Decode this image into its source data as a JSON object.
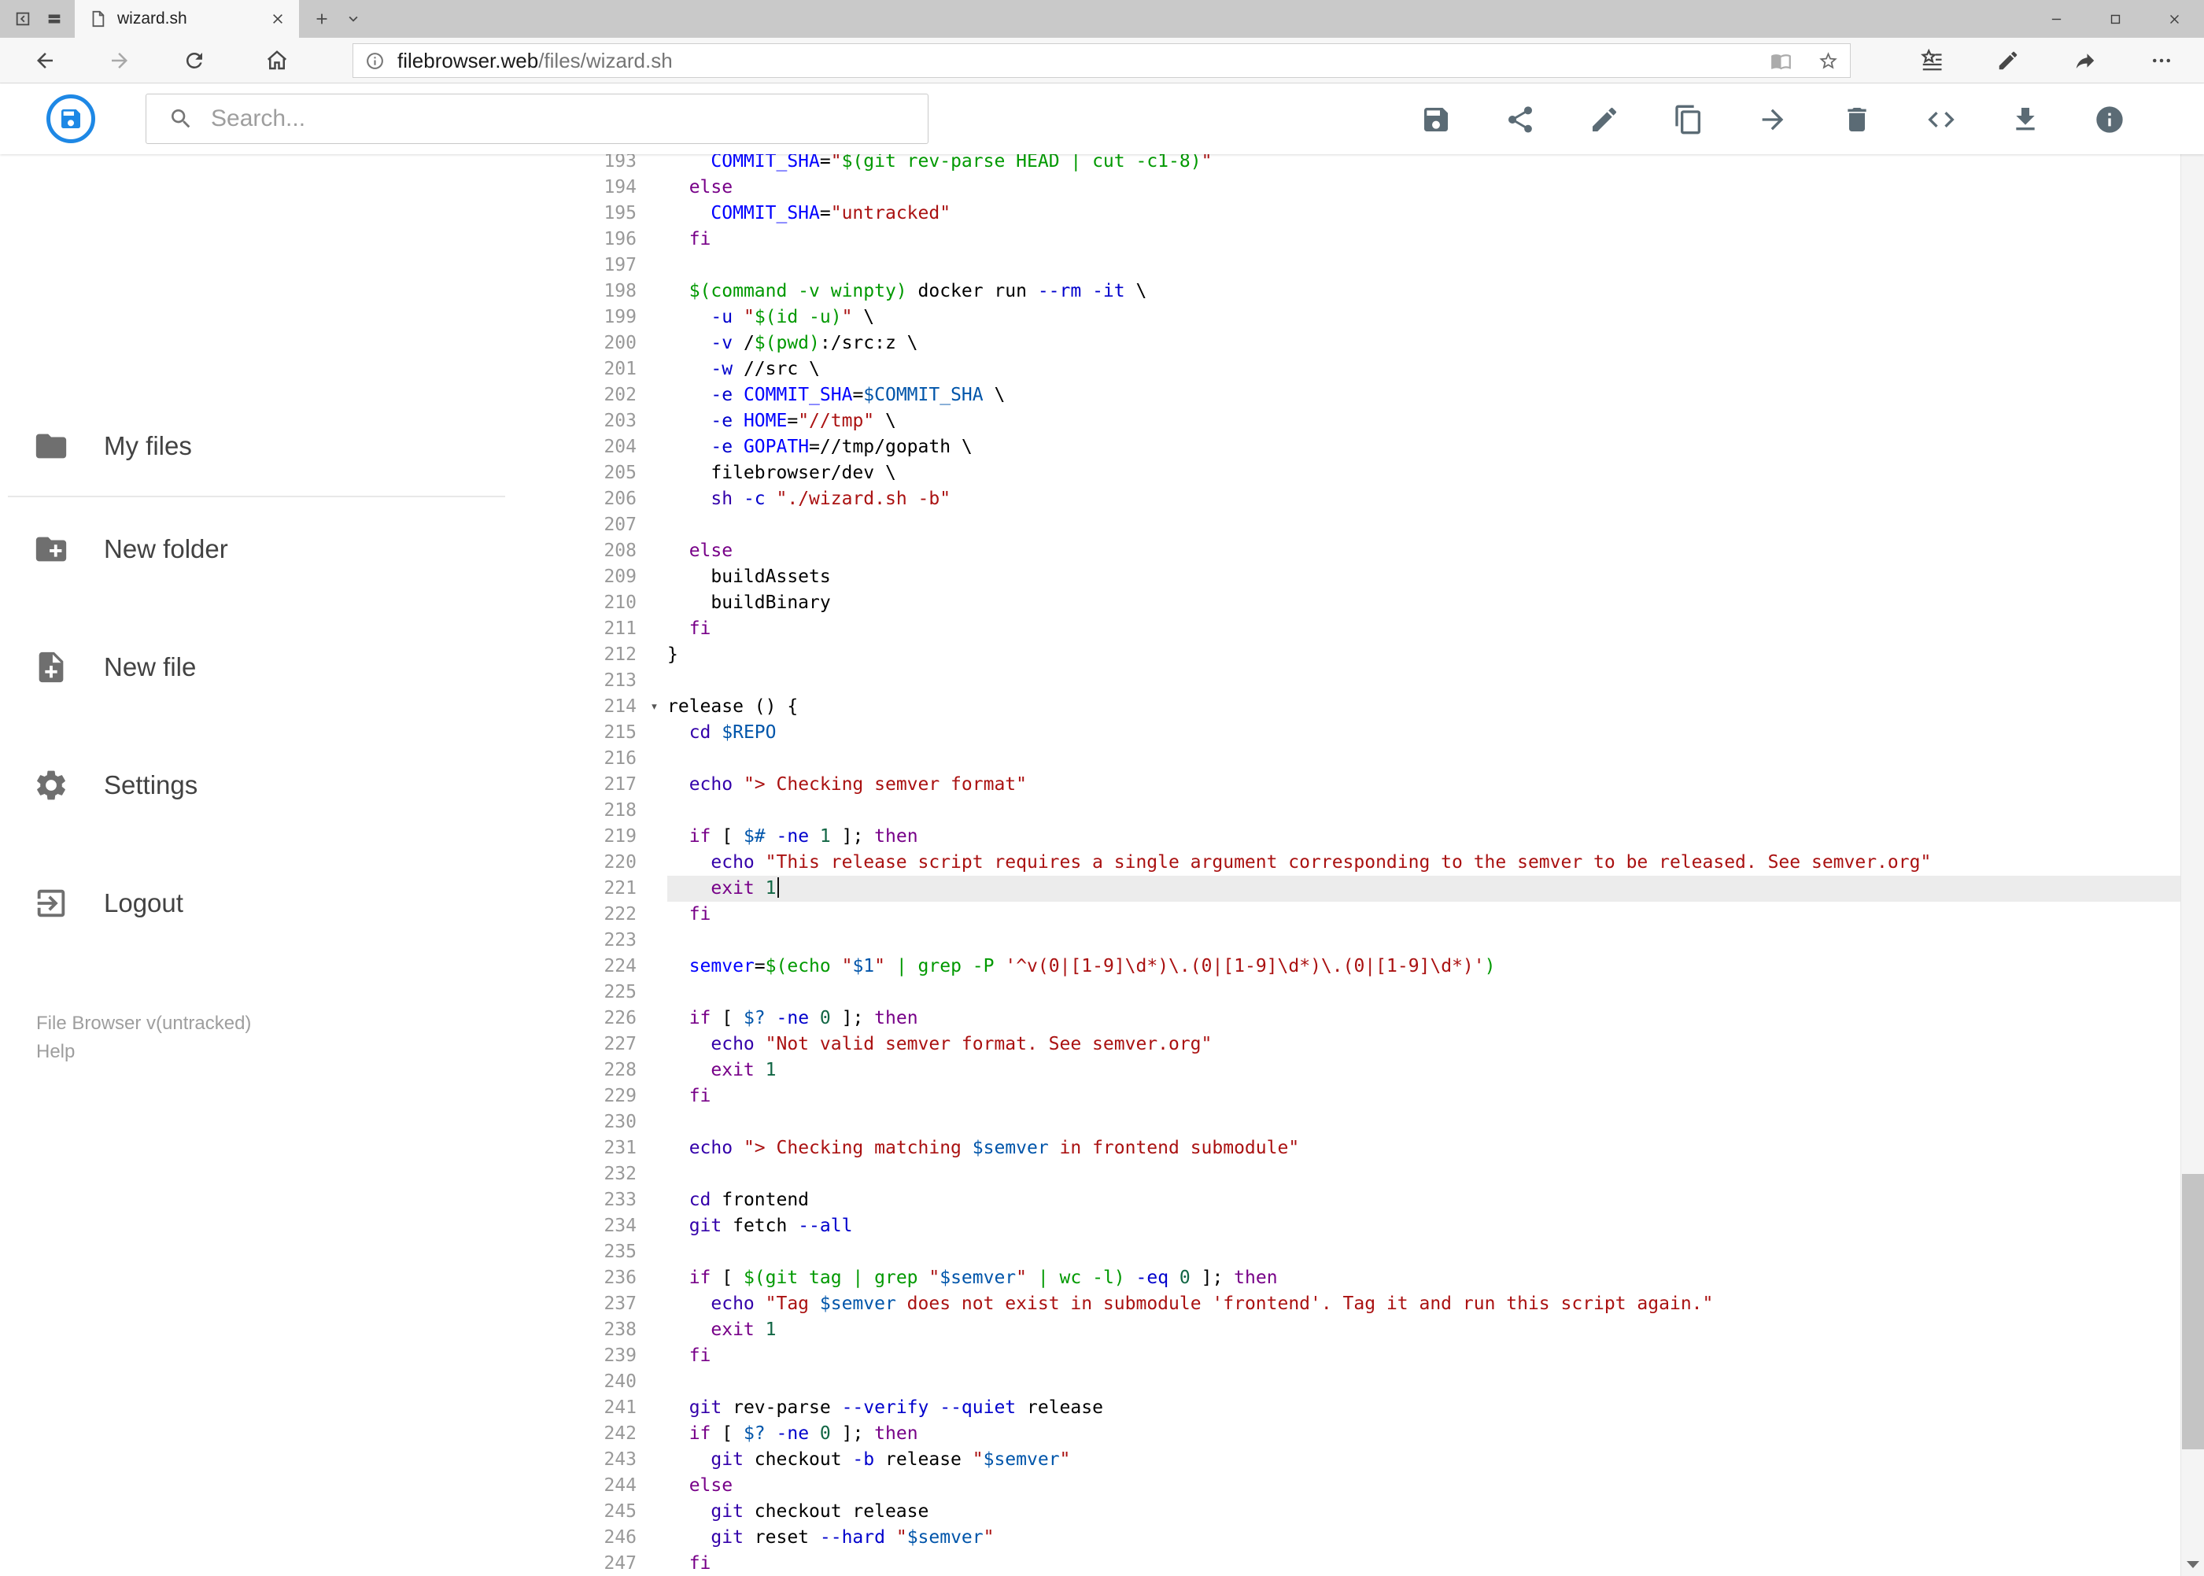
{
  "browser": {
    "tab_title": "wizard.sh",
    "url_domain": "filebrowser.web",
    "url_path": "/files/wizard.sh"
  },
  "header": {
    "search_placeholder": "Search...",
    "accent_color": "#1e88e5",
    "toolbar_icons": [
      "save",
      "share",
      "edit",
      "copy",
      "move",
      "delete",
      "code",
      "download",
      "info"
    ]
  },
  "sidebar": {
    "items": [
      {
        "label": "My files",
        "icon": "folder"
      },
      {
        "label": "New folder",
        "icon": "folder-plus"
      },
      {
        "label": "New file",
        "icon": "file-plus"
      },
      {
        "label": "Settings",
        "icon": "gear"
      },
      {
        "label": "Logout",
        "icon": "logout"
      }
    ],
    "version": "File Browser v(untracked)",
    "help": "Help"
  },
  "editor": {
    "active_line": 221,
    "fold_markers": [
      214
    ],
    "syntax_colors": {
      "keyword": "#708",
      "builtin": "#30a",
      "attribute": "#00c",
      "number": "#164",
      "string": "#a11",
      "quote": "#090",
      "variable": "#05a",
      "def": "#00f",
      "plain": "#000",
      "line_number": "#999",
      "active_line_bg": "#ececec"
    },
    "lines": [
      {
        "n": 193,
        "t": [
          [
            "p",
            "    "
          ],
          [
            "def",
            "COMMIT_SHA"
          ],
          [
            "p",
            "="
          ],
          [
            "s",
            "\""
          ],
          [
            "q",
            "$(git rev-parse HEAD | cut -c1-8)"
          ],
          [
            "s",
            "\""
          ]
        ]
      },
      {
        "n": 194,
        "t": [
          [
            "p",
            "  "
          ],
          [
            "kw",
            "else"
          ]
        ]
      },
      {
        "n": 195,
        "t": [
          [
            "p",
            "    "
          ],
          [
            "def",
            "COMMIT_SHA"
          ],
          [
            "p",
            "="
          ],
          [
            "s",
            "\"untracked\""
          ]
        ]
      },
      {
        "n": 196,
        "t": [
          [
            "p",
            "  "
          ],
          [
            "kw",
            "fi"
          ]
        ]
      },
      {
        "n": 197,
        "t": []
      },
      {
        "n": 198,
        "t": [
          [
            "p",
            "  "
          ],
          [
            "q",
            "$(command -v winpty)"
          ],
          [
            "p",
            " docker run "
          ],
          [
            "at",
            "--rm"
          ],
          [
            "p",
            " "
          ],
          [
            "at",
            "-it"
          ],
          [
            "p",
            " \\"
          ]
        ]
      },
      {
        "n": 199,
        "t": [
          [
            "p",
            "    "
          ],
          [
            "at",
            "-u"
          ],
          [
            "p",
            " "
          ],
          [
            "s",
            "\""
          ],
          [
            "q",
            "$(id -u)"
          ],
          [
            "s",
            "\""
          ],
          [
            "p",
            " \\"
          ]
        ]
      },
      {
        "n": 200,
        "t": [
          [
            "p",
            "    "
          ],
          [
            "at",
            "-v"
          ],
          [
            "p",
            " /"
          ],
          [
            "q",
            "$(pwd)"
          ],
          [
            "p",
            ":/src:z \\"
          ]
        ]
      },
      {
        "n": 201,
        "t": [
          [
            "p",
            "    "
          ],
          [
            "at",
            "-w"
          ],
          [
            "p",
            " //src \\"
          ]
        ]
      },
      {
        "n": 202,
        "t": [
          [
            "p",
            "    "
          ],
          [
            "at",
            "-e"
          ],
          [
            "p",
            " "
          ],
          [
            "def",
            "COMMIT_SHA"
          ],
          [
            "p",
            "="
          ],
          [
            "v",
            "$COMMIT_SHA"
          ],
          [
            "p",
            " \\"
          ]
        ]
      },
      {
        "n": 203,
        "t": [
          [
            "p",
            "    "
          ],
          [
            "at",
            "-e"
          ],
          [
            "p",
            " "
          ],
          [
            "def",
            "HOME"
          ],
          [
            "p",
            "="
          ],
          [
            "s",
            "\"//tmp\""
          ],
          [
            "p",
            " \\"
          ]
        ]
      },
      {
        "n": 204,
        "t": [
          [
            "p",
            "    "
          ],
          [
            "at",
            "-e"
          ],
          [
            "p",
            " "
          ],
          [
            "def",
            "GOPATH"
          ],
          [
            "p",
            "=//tmp/gopath \\"
          ]
        ]
      },
      {
        "n": 205,
        "t": [
          [
            "p",
            "    filebrowser/dev \\"
          ]
        ]
      },
      {
        "n": 206,
        "t": [
          [
            "p",
            "    "
          ],
          [
            "bi",
            "sh"
          ],
          [
            "p",
            " "
          ],
          [
            "at",
            "-c"
          ],
          [
            "p",
            " "
          ],
          [
            "s",
            "\"./wizard.sh -b\""
          ]
        ]
      },
      {
        "n": 207,
        "t": []
      },
      {
        "n": 208,
        "t": [
          [
            "p",
            "  "
          ],
          [
            "kw",
            "else"
          ]
        ]
      },
      {
        "n": 209,
        "t": [
          [
            "p",
            "    buildAssets"
          ]
        ]
      },
      {
        "n": 210,
        "t": [
          [
            "p",
            "    buildBinary"
          ]
        ]
      },
      {
        "n": 211,
        "t": [
          [
            "p",
            "  "
          ],
          [
            "kw",
            "fi"
          ]
        ]
      },
      {
        "n": 212,
        "t": [
          [
            "p",
            "}"
          ]
        ]
      },
      {
        "n": 213,
        "t": []
      },
      {
        "n": 214,
        "t": [
          [
            "p",
            "release () {"
          ]
        ]
      },
      {
        "n": 215,
        "t": [
          [
            "p",
            "  "
          ],
          [
            "bi",
            "cd"
          ],
          [
            "p",
            " "
          ],
          [
            "v",
            "$REPO"
          ]
        ]
      },
      {
        "n": 216,
        "t": []
      },
      {
        "n": 217,
        "t": [
          [
            "p",
            "  "
          ],
          [
            "bi",
            "echo"
          ],
          [
            "p",
            " "
          ],
          [
            "s",
            "\"> Checking semver format\""
          ]
        ]
      },
      {
        "n": 218,
        "t": []
      },
      {
        "n": 219,
        "t": [
          [
            "p",
            "  "
          ],
          [
            "kw",
            "if"
          ],
          [
            "p",
            " [ "
          ],
          [
            "v",
            "$#"
          ],
          [
            "p",
            " "
          ],
          [
            "at",
            "-ne"
          ],
          [
            "p",
            " "
          ],
          [
            "num",
            "1"
          ],
          [
            "p",
            " ]; "
          ],
          [
            "kw",
            "then"
          ]
        ]
      },
      {
        "n": 220,
        "t": [
          [
            "p",
            "    "
          ],
          [
            "bi",
            "echo"
          ],
          [
            "p",
            " "
          ],
          [
            "s",
            "\"This release script requires a single argument corresponding to the semver to be released. See semver.org\""
          ]
        ]
      },
      {
        "n": 221,
        "t": [
          [
            "p",
            "    "
          ],
          [
            "kw",
            "exit"
          ],
          [
            "p",
            " "
          ],
          [
            "num",
            "1"
          ]
        ]
      },
      {
        "n": 222,
        "t": [
          [
            "p",
            "  "
          ],
          [
            "kw",
            "fi"
          ]
        ]
      },
      {
        "n": 223,
        "t": []
      },
      {
        "n": 224,
        "t": [
          [
            "p",
            "  "
          ],
          [
            "def",
            "semver"
          ],
          [
            "p",
            "="
          ],
          [
            "q",
            "$(echo "
          ],
          [
            "s",
            "\""
          ],
          [
            "v",
            "$1"
          ],
          [
            "s",
            "\""
          ],
          [
            "q",
            " | grep -P "
          ],
          [
            "s",
            "'^v(0|[1-9]\\d*)\\.(0|[1-9]\\d*)\\.(0|[1-9]\\d*)'"
          ],
          [
            "q",
            ")"
          ]
        ]
      },
      {
        "n": 225,
        "t": []
      },
      {
        "n": 226,
        "t": [
          [
            "p",
            "  "
          ],
          [
            "kw",
            "if"
          ],
          [
            "p",
            " [ "
          ],
          [
            "v",
            "$?"
          ],
          [
            "p",
            " "
          ],
          [
            "at",
            "-ne"
          ],
          [
            "p",
            " "
          ],
          [
            "num",
            "0"
          ],
          [
            "p",
            " ]; "
          ],
          [
            "kw",
            "then"
          ]
        ]
      },
      {
        "n": 227,
        "t": [
          [
            "p",
            "    "
          ],
          [
            "bi",
            "echo"
          ],
          [
            "p",
            " "
          ],
          [
            "s",
            "\"Not valid semver format. See semver.org\""
          ]
        ]
      },
      {
        "n": 228,
        "t": [
          [
            "p",
            "    "
          ],
          [
            "kw",
            "exit"
          ],
          [
            "p",
            " "
          ],
          [
            "num",
            "1"
          ]
        ]
      },
      {
        "n": 229,
        "t": [
          [
            "p",
            "  "
          ],
          [
            "kw",
            "fi"
          ]
        ]
      },
      {
        "n": 230,
        "t": []
      },
      {
        "n": 231,
        "t": [
          [
            "p",
            "  "
          ],
          [
            "bi",
            "echo"
          ],
          [
            "p",
            " "
          ],
          [
            "s",
            "\"> Checking matching "
          ],
          [
            "v",
            "$semver"
          ],
          [
            "s",
            " in frontend submodule\""
          ]
        ]
      },
      {
        "n": 232,
        "t": []
      },
      {
        "n": 233,
        "t": [
          [
            "p",
            "  "
          ],
          [
            "bi",
            "cd"
          ],
          [
            "p",
            " frontend"
          ]
        ]
      },
      {
        "n": 234,
        "t": [
          [
            "p",
            "  "
          ],
          [
            "bi",
            "git"
          ],
          [
            "p",
            " fetch "
          ],
          [
            "at",
            "--all"
          ]
        ]
      },
      {
        "n": 235,
        "t": []
      },
      {
        "n": 236,
        "t": [
          [
            "p",
            "  "
          ],
          [
            "kw",
            "if"
          ],
          [
            "p",
            " [ "
          ],
          [
            "q",
            "$(git tag | grep "
          ],
          [
            "s",
            "\""
          ],
          [
            "v",
            "$semver"
          ],
          [
            "s",
            "\""
          ],
          [
            "q",
            " | wc -l)"
          ],
          [
            "p",
            " "
          ],
          [
            "at",
            "-eq"
          ],
          [
            "p",
            " "
          ],
          [
            "num",
            "0"
          ],
          [
            "p",
            " ]; "
          ],
          [
            "kw",
            "then"
          ]
        ]
      },
      {
        "n": 237,
        "t": [
          [
            "p",
            "    "
          ],
          [
            "bi",
            "echo"
          ],
          [
            "p",
            " "
          ],
          [
            "s",
            "\"Tag "
          ],
          [
            "v",
            "$semver"
          ],
          [
            "s",
            " does not exist in submodule 'frontend'. Tag it and run this script again.\""
          ]
        ]
      },
      {
        "n": 238,
        "t": [
          [
            "p",
            "    "
          ],
          [
            "kw",
            "exit"
          ],
          [
            "p",
            " "
          ],
          [
            "num",
            "1"
          ]
        ]
      },
      {
        "n": 239,
        "t": [
          [
            "p",
            "  "
          ],
          [
            "kw",
            "fi"
          ]
        ]
      },
      {
        "n": 240,
        "t": []
      },
      {
        "n": 241,
        "t": [
          [
            "p",
            "  "
          ],
          [
            "bi",
            "git"
          ],
          [
            "p",
            " rev-parse "
          ],
          [
            "at",
            "--verify"
          ],
          [
            "p",
            " "
          ],
          [
            "at",
            "--quiet"
          ],
          [
            "p",
            " release"
          ]
        ]
      },
      {
        "n": 242,
        "t": [
          [
            "p",
            "  "
          ],
          [
            "kw",
            "if"
          ],
          [
            "p",
            " [ "
          ],
          [
            "v",
            "$?"
          ],
          [
            "p",
            " "
          ],
          [
            "at",
            "-ne"
          ],
          [
            "p",
            " "
          ],
          [
            "num",
            "0"
          ],
          [
            "p",
            " ]; "
          ],
          [
            "kw",
            "then"
          ]
        ]
      },
      {
        "n": 243,
        "t": [
          [
            "p",
            "    "
          ],
          [
            "bi",
            "git"
          ],
          [
            "p",
            " checkout "
          ],
          [
            "at",
            "-b"
          ],
          [
            "p",
            " release "
          ],
          [
            "s",
            "\""
          ],
          [
            "v",
            "$semver"
          ],
          [
            "s",
            "\""
          ]
        ]
      },
      {
        "n": 244,
        "t": [
          [
            "p",
            "  "
          ],
          [
            "kw",
            "else"
          ]
        ]
      },
      {
        "n": 245,
        "t": [
          [
            "p",
            "    "
          ],
          [
            "bi",
            "git"
          ],
          [
            "p",
            " checkout release"
          ]
        ]
      },
      {
        "n": 246,
        "t": [
          [
            "p",
            "    "
          ],
          [
            "bi",
            "git"
          ],
          [
            "p",
            " reset "
          ],
          [
            "at",
            "--hard"
          ],
          [
            "p",
            " "
          ],
          [
            "s",
            "\""
          ],
          [
            "v",
            "$semver"
          ],
          [
            "s",
            "\""
          ]
        ]
      },
      {
        "n": 247,
        "t": [
          [
            "p",
            "  "
          ],
          [
            "kw",
            "fi"
          ]
        ]
      }
    ]
  }
}
